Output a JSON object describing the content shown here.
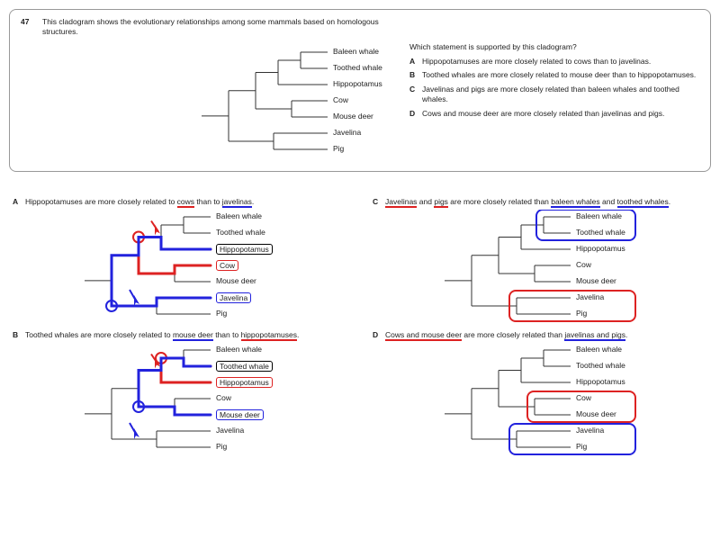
{
  "question": {
    "number": "47",
    "text": "This cladogram shows the evolutionary relationships among some mammals based on homologous structures.",
    "prompt": "Which statement is supported by this cladogram?",
    "taxa": [
      "Baleen whale",
      "Toothed whale",
      "Hippopotamus",
      "Cow",
      "Mouse deer",
      "Javelina",
      "Pig"
    ],
    "options": [
      {
        "letter": "A",
        "text": "Hippopotamuses are more closely related to cows than to javelinas."
      },
      {
        "letter": "B",
        "text": "Toothed whales are more closely related to mouse deer than to hippopotamuses."
      },
      {
        "letter": "C",
        "text": "Javelinas and pigs are more closely related than baleen whales and toothed whales."
      },
      {
        "letter": "D",
        "text": "Cows and mouse deer are more closely related than javelinas and pigs."
      }
    ]
  },
  "explanations": {
    "A": {
      "label": "A",
      "prefix": "Hippopotamuses are more closely related to ",
      "t1": "cows",
      "t1_style": "ul-red",
      "middle": " than to ",
      "t2": "javelinas",
      "t2_style": "ul-blue",
      "suffix": ".",
      "highlights": {
        "Hippopotamus": "boxed-black",
        "Cow": "boxed-red",
        "Javelina": "boxed-blue"
      },
      "paths": {
        "red_to": "Cow",
        "blue_to": "Javelina"
      },
      "arrows": true
    },
    "B": {
      "label": "B",
      "prefix": "Toothed whales are more closely related to ",
      "t1": "mouse deer",
      "t1_style": "ul-blue",
      "middle": " than to ",
      "t2": "hippopotamuses",
      "t2_style": "ul-red",
      "suffix": ".",
      "highlights": {
        "Toothed whale": "boxed-black",
        "Hippopotamus": "boxed-red",
        "Mouse deer": "boxed-blue"
      },
      "paths": {
        "red_to": "Hippopotamus",
        "blue_to": "Mouse deer"
      },
      "arrows": true
    },
    "C": {
      "label": "C",
      "prefix": "",
      "t1": "Javelinas",
      "t1_style": "ul-red",
      "middle1": " and ",
      "t2": "pigs",
      "t2_style": "ul-red",
      "middle2": " are more closely related than ",
      "t3": "baleen whales",
      "t3_style": "ul-blue",
      "middle3": " and ",
      "t4": "toothed whales",
      "t4_style": "ul-blue",
      "suffix": ".",
      "group_boxes": [
        {
          "taxa": [
            "Baleen whale",
            "Toothed whale"
          ],
          "color": "#22d"
        },
        {
          "taxa": [
            "Javelina",
            "Pig"
          ],
          "color": "#d22"
        }
      ]
    },
    "D": {
      "label": "D",
      "prefix": "",
      "t1": "Cows and mouse deer",
      "t1_style": "ul-red",
      "middle": " are more closely related than ",
      "t2": "javelinas and pigs",
      "t2_style": "ul-blue",
      "suffix": ".",
      "group_boxes": [
        {
          "taxa": [
            "Cow",
            "Mouse deer"
          ],
          "color": "#d22"
        },
        {
          "taxa": [
            "Javelina",
            "Pig"
          ],
          "color": "#22d"
        }
      ]
    }
  },
  "chart_data": {
    "type": "cladogram",
    "taxa": [
      "Baleen whale",
      "Toothed whale",
      "Hippopotamus",
      "Cow",
      "Mouse deer",
      "Javelina",
      "Pig"
    ],
    "newick": "(((((Baleen whale,Toothed whale),Hippopotamus),(Cow,Mouse deer)),(Javelina,Pig)));",
    "note": "rooted rectangular cladogram, equal branch spacing"
  }
}
